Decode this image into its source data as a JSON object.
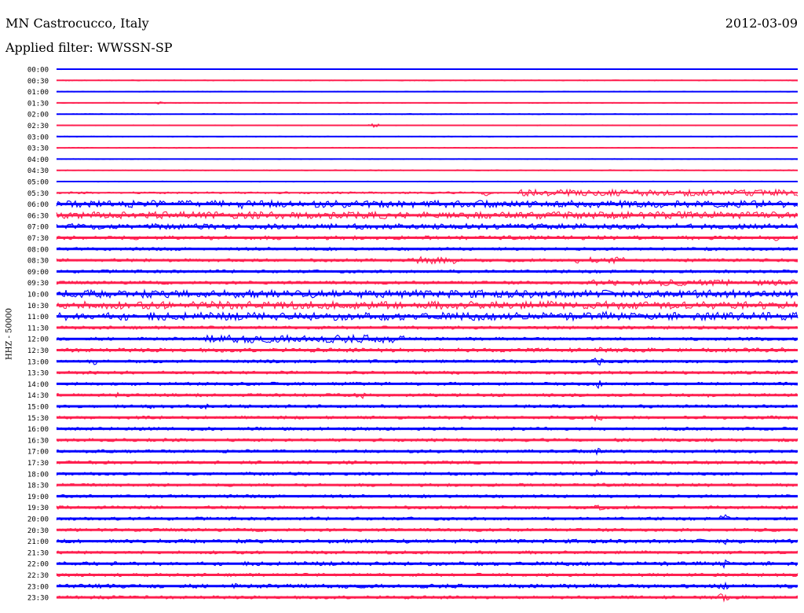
{
  "header": {
    "station": "MN Castrocucco, Italy",
    "date": "2012-03-09",
    "filter": "Applied filter: WWSSN-SP"
  },
  "axis": {
    "ylabel": "HHZ - 50000"
  },
  "colors": {
    "even_rows": "#0000ff",
    "odd_rows": "#ff1f4f",
    "background": "#ffffff"
  },
  "chart_data": {
    "type": "line",
    "description_of_rows": "helicorder, one trace per 30 minutes",
    "rows": [
      {
        "label": "00:00",
        "amp": 1.0,
        "events": []
      },
      {
        "label": "00:30",
        "amp": 1.2,
        "events": [
          {
            "t": 0.56,
            "amp": 2
          }
        ]
      },
      {
        "label": "01:00",
        "amp": 1.0,
        "events": []
      },
      {
        "label": "01:30",
        "amp": 1.2,
        "events": [
          {
            "t": 0.14,
            "amp": 4
          },
          {
            "t": 0.23,
            "amp": 2
          },
          {
            "t": 0.44,
            "amp": 2
          }
        ]
      },
      {
        "label": "02:00",
        "amp": 1.2,
        "events": []
      },
      {
        "label": "02:30",
        "amp": 1.2,
        "events": [
          {
            "t": 0.43,
            "amp": 7
          }
        ]
      },
      {
        "label": "03:00",
        "amp": 1.0,
        "events": []
      },
      {
        "label": "03:30",
        "amp": 1.2,
        "events": []
      },
      {
        "label": "04:00",
        "amp": 1.0,
        "events": []
      },
      {
        "label": "04:30",
        "amp": 1.2,
        "events": [
          {
            "t": 0.44,
            "amp": 2
          }
        ]
      },
      {
        "label": "05:00",
        "amp": 1.2,
        "events": []
      },
      {
        "label": "05:30",
        "amp": 2.5,
        "events": [
          {
            "t": 0.58,
            "amp": 10
          }
        ],
        "bursts": [
          [
            0.62,
            1.0,
            8
          ]
        ]
      },
      {
        "label": "06:00",
        "amp": 9,
        "events": [
          {
            "t": 0.25,
            "amp": 12
          }
        ]
      },
      {
        "label": "06:30",
        "amp": 9,
        "events": []
      },
      {
        "label": "07:00",
        "amp": 7,
        "events": [
          {
            "t": 0.93,
            "amp": 8
          }
        ]
      },
      {
        "label": "07:30",
        "amp": 5,
        "events": [
          {
            "t": 0.97,
            "amp": 10
          }
        ]
      },
      {
        "label": "08:00",
        "amp": 4,
        "events": []
      },
      {
        "label": "08:30",
        "amp": 4,
        "events": [],
        "bursts": [
          [
            0.48,
            0.55,
            9
          ],
          [
            0.7,
            0.77,
            8
          ]
        ]
      },
      {
        "label": "09:00",
        "amp": 4,
        "events": []
      },
      {
        "label": "09:30",
        "amp": 4,
        "events": [],
        "bursts": [
          [
            0.72,
            1.0,
            8
          ]
        ]
      },
      {
        "label": "10:00",
        "amp": 10,
        "events": []
      },
      {
        "label": "10:30",
        "amp": 10,
        "events": []
      },
      {
        "label": "11:00",
        "amp": 10,
        "events": [
          {
            "t": 0.74,
            "amp": 14
          }
        ]
      },
      {
        "label": "11:30",
        "amp": 4,
        "events": []
      },
      {
        "label": "12:00",
        "amp": 4,
        "events": [],
        "bursts": [
          [
            0.2,
            0.47,
            10
          ]
        ]
      },
      {
        "label": "12:30",
        "amp": 5,
        "events": [
          {
            "t": 0.73,
            "amp": 12
          },
          {
            "t": 0.98,
            "amp": 8
          }
        ]
      },
      {
        "label": "13:00",
        "amp": 4,
        "events": [
          {
            "t": 0.05,
            "amp": 10
          },
          {
            "t": 0.61,
            "amp": 9
          },
          {
            "t": 0.73,
            "amp": 14
          }
        ]
      },
      {
        "label": "13:30",
        "amp": 4,
        "events": []
      },
      {
        "label": "14:00",
        "amp": 4,
        "events": [
          {
            "t": 0.73,
            "amp": 14
          }
        ]
      },
      {
        "label": "14:30",
        "amp": 4,
        "events": [
          {
            "t": 0.08,
            "amp": 8
          },
          {
            "t": 0.41,
            "amp": 12
          },
          {
            "t": 0.88,
            "amp": 8
          }
        ]
      },
      {
        "label": "15:00",
        "amp": 4,
        "events": [
          {
            "t": 0.13,
            "amp": 8
          },
          {
            "t": 0.2,
            "amp": 10
          },
          {
            "t": 0.71,
            "amp": 10
          }
        ]
      },
      {
        "label": "15:30",
        "amp": 4,
        "events": [
          {
            "t": 0.73,
            "amp": 14
          }
        ]
      },
      {
        "label": "16:00",
        "amp": 4,
        "events": []
      },
      {
        "label": "16:30",
        "amp": 4,
        "events": []
      },
      {
        "label": "17:00",
        "amp": 4,
        "events": [
          {
            "t": 0.73,
            "amp": 14
          }
        ]
      },
      {
        "label": "17:30",
        "amp": 4,
        "events": []
      },
      {
        "label": "18:00",
        "amp": 4,
        "events": [
          {
            "t": 0.73,
            "amp": 14
          }
        ]
      },
      {
        "label": "18:30",
        "amp": 4,
        "events": []
      },
      {
        "label": "19:00",
        "amp": 4,
        "events": [
          {
            "t": 0.11,
            "amp": 6
          }
        ]
      },
      {
        "label": "19:30",
        "amp": 4,
        "events": [
          {
            "t": 0.73,
            "amp": 14
          },
          {
            "t": 0.9,
            "amp": 14
          }
        ]
      },
      {
        "label": "20:00",
        "amp": 4,
        "events": [
          {
            "t": 0.9,
            "amp": 14
          }
        ]
      },
      {
        "label": "20:30",
        "amp": 4,
        "events": []
      },
      {
        "label": "21:00",
        "amp": 5,
        "events": [
          {
            "t": 0.9,
            "amp": 14
          }
        ]
      },
      {
        "label": "21:30",
        "amp": 4,
        "events": []
      },
      {
        "label": "22:00",
        "amp": 5,
        "events": [
          {
            "t": 0.9,
            "amp": 14
          }
        ]
      },
      {
        "label": "22:30",
        "amp": 4,
        "events": []
      },
      {
        "label": "23:00",
        "amp": 5,
        "events": [
          {
            "t": 0.24,
            "amp": 8
          },
          {
            "t": 0.9,
            "amp": 16
          }
        ]
      },
      {
        "label": "23:30",
        "amp": 4,
        "events": [
          {
            "t": 0.9,
            "amp": 14
          }
        ]
      }
    ]
  }
}
